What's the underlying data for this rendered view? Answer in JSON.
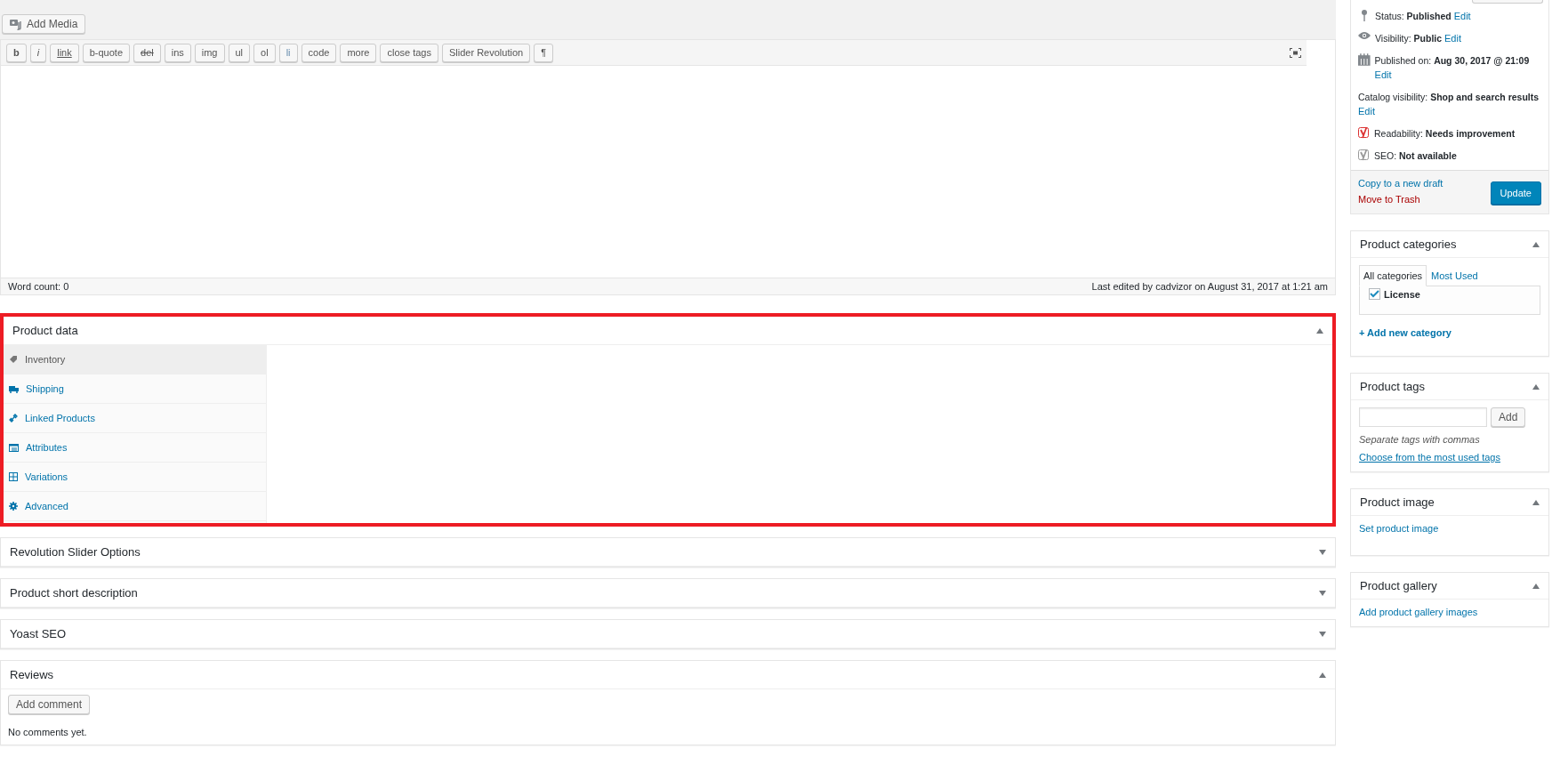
{
  "editor": {
    "add_media": "Add Media",
    "quicktags": [
      {
        "label": "b",
        "kind": "bold"
      },
      {
        "label": "i",
        "kind": "italic"
      },
      {
        "label": "link",
        "kind": "underline"
      },
      {
        "label": "b-quote",
        "kind": "plain"
      },
      {
        "label": "del",
        "kind": "strike"
      },
      {
        "label": "ins",
        "kind": "plain"
      },
      {
        "label": "img",
        "kind": "plain"
      },
      {
        "label": "ul",
        "kind": "plain"
      },
      {
        "label": "ol",
        "kind": "plain"
      },
      {
        "label": "li",
        "kind": "muted"
      },
      {
        "label": "code",
        "kind": "plain"
      },
      {
        "label": "more",
        "kind": "plain"
      },
      {
        "label": "close tags",
        "kind": "plain"
      },
      {
        "label": "Slider Revolution",
        "kind": "plain"
      },
      {
        "label": "¶",
        "kind": "plain"
      }
    ],
    "word_count": "Word count: 0",
    "last_edited": "Last edited by cadvizor on August 31, 2017 at 1:21 am"
  },
  "product_data": {
    "title": "Product data",
    "expanded": true,
    "tabs": [
      {
        "label": "Inventory",
        "kind": "tag",
        "selected": true
      },
      {
        "label": "Shipping",
        "kind": "truck",
        "selected": false
      },
      {
        "label": "Linked Products",
        "kind": "link",
        "selected": false
      },
      {
        "label": "Attributes",
        "kind": "list",
        "selected": false
      },
      {
        "label": "Variations",
        "kind": "grid",
        "selected": false
      },
      {
        "label": "Advanced",
        "kind": "gear",
        "selected": false
      }
    ]
  },
  "boxes": [
    {
      "title": "Revolution Slider Options",
      "expanded": false
    },
    {
      "title": "Product short description",
      "expanded": false
    },
    {
      "title": "Yoast SEO",
      "expanded": false
    },
    {
      "title": "Reviews",
      "expanded": true,
      "button": "Add comment",
      "note": "No comments yet."
    }
  ],
  "publish": {
    "rows": [
      {
        "kind": "pin",
        "label": "Status:",
        "value": "Published",
        "link": "Edit"
      },
      {
        "kind": "eye",
        "label": "Visibility:",
        "value": "Public",
        "link": "Edit"
      },
      {
        "kind": "calendar",
        "label": "Published on:",
        "value": "Aug 30, 2017 @ 21:09",
        "link": "Edit"
      },
      {
        "kind": "none",
        "label": "Catalog visibility:",
        "value": "Shop and search results",
        "link": "Edit"
      },
      {
        "kind": "yoast-bad",
        "label": "Readability:",
        "value": "Needs improvement"
      },
      {
        "kind": "yoast-na",
        "label": "SEO:",
        "value": "Not available"
      }
    ],
    "copy_link": "Copy to a new draft",
    "trash_link": "Move to Trash",
    "update_button": "Update"
  },
  "categories": {
    "title": "Product categories",
    "expanded": true,
    "tabs": [
      {
        "label": "All categories",
        "selected": true
      },
      {
        "label": "Most Used",
        "selected": false
      }
    ],
    "items": [
      {
        "label": "License",
        "checked": true
      }
    ],
    "add_link": "+ Add new category"
  },
  "tags": {
    "title": "Product tags",
    "expanded": true,
    "button": "Add",
    "hint": "Separate tags with commas",
    "link": "Choose from the most used tags"
  },
  "image": {
    "title": "Product image",
    "expanded": true,
    "link": "Set product image"
  },
  "gallery": {
    "title": "Product gallery",
    "expanded": true,
    "link": "Add product gallery images"
  }
}
